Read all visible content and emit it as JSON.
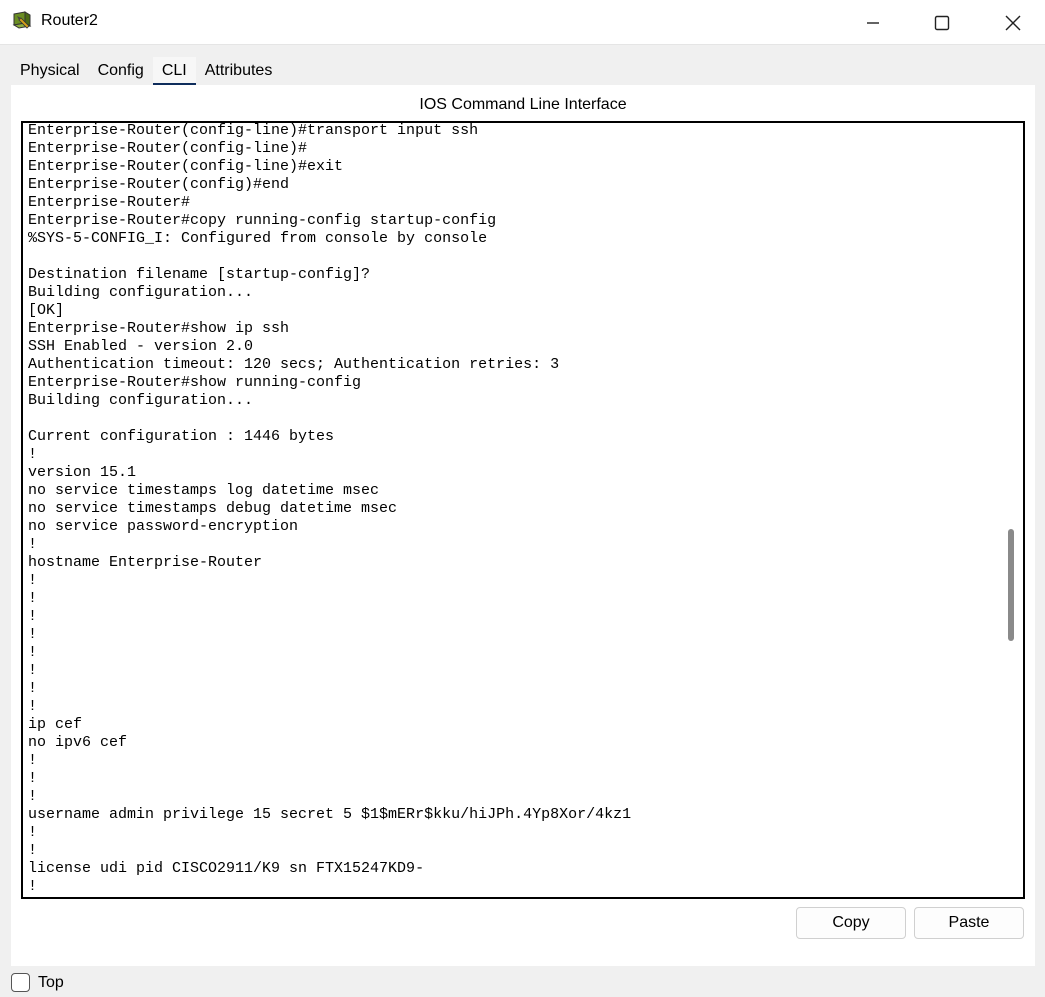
{
  "window": {
    "title": "Router2",
    "icon": "router-icon"
  },
  "window_controls": [
    "minimize-icon",
    "maximize-icon",
    "close-icon"
  ],
  "tabs": [
    {
      "label": "Physical",
      "active": false
    },
    {
      "label": "Config",
      "active": false
    },
    {
      "label": "CLI",
      "active": true
    },
    {
      "label": "Attributes",
      "active": false
    }
  ],
  "cli": {
    "title": "IOS Command Line Interface",
    "lines": [
      "Enterprise-Router(config-line)#transport input ssh",
      "Enterprise-Router(config-line)#",
      "Enterprise-Router(config-line)#exit",
      "Enterprise-Router(config)#end",
      "Enterprise-Router#",
      "Enterprise-Router#copy running-config startup-config",
      "%SYS-5-CONFIG_I: Configured from console by console",
      "",
      "Destination filename [startup-config]?",
      "Building configuration...",
      "[OK]",
      "Enterprise-Router#show ip ssh",
      "SSH Enabled - version 2.0",
      "Authentication timeout: 120 secs; Authentication retries: 3",
      "Enterprise-Router#show running-config",
      "Building configuration...",
      "",
      "Current configuration : 1446 bytes",
      "!",
      "version 15.1",
      "no service timestamps log datetime msec",
      "no service timestamps debug datetime msec",
      "no service password-encryption",
      "!",
      "hostname Enterprise-Router",
      "!",
      "!",
      "!",
      "!",
      "!",
      "!",
      "!",
      "!",
      "ip cef",
      "no ipv6 cef",
      "!",
      "!",
      "!",
      "username admin privilege 15 secret 5 $1$mERr$kku/hiJPh.4Yp8Xor/4kz1",
      "!",
      "!",
      "license udi pid CISCO2911/K9 sn FTX15247KD9-",
      "!"
    ]
  },
  "buttons": {
    "copy": "Copy",
    "paste": "Paste"
  },
  "top_checkbox": {
    "label": "Top",
    "checked": false
  }
}
